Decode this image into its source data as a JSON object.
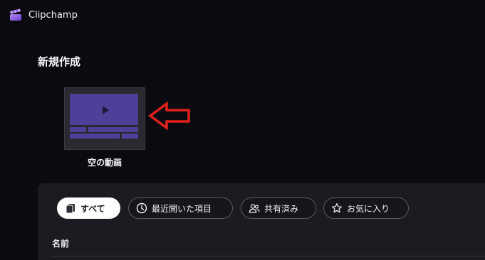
{
  "app": {
    "title": "Clipchamp",
    "logo_icon": "clipchamp-clapper-icon",
    "accent_color": "#7b5cd6"
  },
  "create_section": {
    "title": "新規作成",
    "templates": [
      {
        "label": "空の動画",
        "icon": "video-timeline-thumbnail",
        "thumbnail_color": "#4f3f98"
      }
    ],
    "annotation": {
      "icon": "red-arrow-left",
      "color": "#e0201c"
    }
  },
  "library": {
    "filters": [
      {
        "label": "すべて",
        "icon": "stack-icon",
        "active": true
      },
      {
        "label": "最近開いた項目",
        "icon": "clock-icon",
        "active": false
      },
      {
        "label": "共有済み",
        "icon": "people-icon",
        "active": false
      },
      {
        "label": "お気に入り",
        "icon": "star-icon",
        "active": false
      }
    ],
    "columns": [
      {
        "label": "名前"
      }
    ]
  }
}
